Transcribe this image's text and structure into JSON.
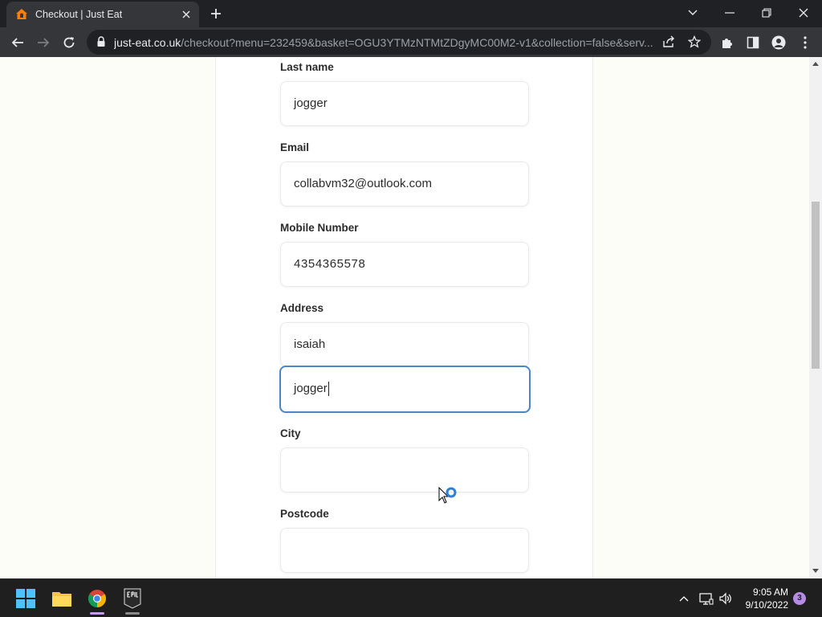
{
  "browser": {
    "tab_title": "Checkout | Just Eat",
    "url_host": "just-eat.co.uk",
    "url_path": "/checkout?menu=232459&basket=OGU3YTMzNTMtZDgyMC00M2-v1&collection=false&serv..."
  },
  "form": {
    "last_name_label": "Last name",
    "last_name_value": "jogger",
    "email_label": "Email",
    "email_value": "collabvm32@outlook.com",
    "mobile_label": "Mobile Number",
    "mobile_value": "4354365578",
    "address_label": "Address",
    "address_line1_value": "isaiah",
    "address_line2_value": "jogger",
    "city_label": "City",
    "city_value": "",
    "postcode_label": "Postcode",
    "postcode_value": ""
  },
  "taskbar": {
    "time": "9:05 AM",
    "date": "9/10/2022",
    "notification_count": "3"
  },
  "colors": {
    "focus_border": "#4a86c8",
    "brand_orange": "#ff8000"
  }
}
